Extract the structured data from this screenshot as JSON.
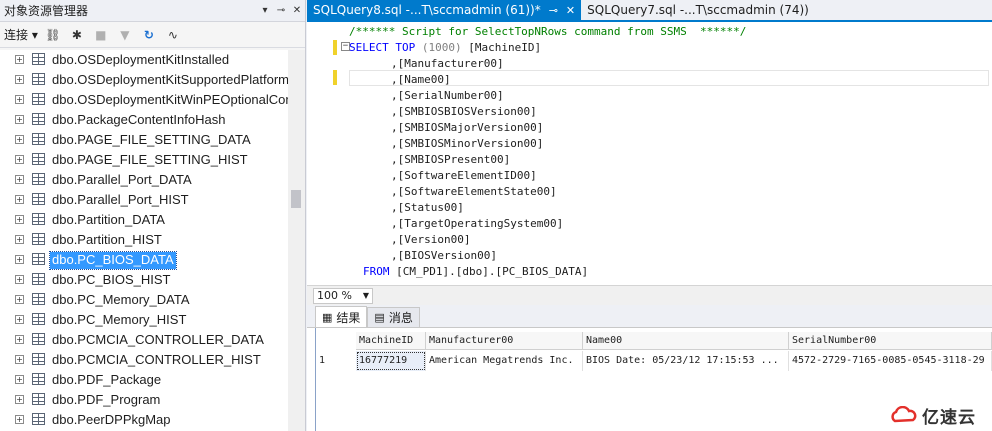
{
  "object_explorer": {
    "title": "对象资源管理器",
    "pin_label": "▾ ䷀",
    "close_label": "✕",
    "connect_label": "连接 ▾",
    "tree": [
      {
        "label": "dbo.OSDeploymentKitInstalled",
        "selected": false
      },
      {
        "label": "dbo.OSDeploymentKitSupportedPlatform",
        "selected": false
      },
      {
        "label": "dbo.OSDeploymentKitWinPEOptionalCom",
        "selected": false
      },
      {
        "label": "dbo.PackageContentInfoHash",
        "selected": false
      },
      {
        "label": "dbo.PAGE_FILE_SETTING_DATA",
        "selected": false
      },
      {
        "label": "dbo.PAGE_FILE_SETTING_HIST",
        "selected": false
      },
      {
        "label": "dbo.Parallel_Port_DATA",
        "selected": false
      },
      {
        "label": "dbo.Parallel_Port_HIST",
        "selected": false
      },
      {
        "label": "dbo.Partition_DATA",
        "selected": false
      },
      {
        "label": "dbo.Partition_HIST",
        "selected": false
      },
      {
        "label": "dbo.PC_BIOS_DATA",
        "selected": true
      },
      {
        "label": "dbo.PC_BIOS_HIST",
        "selected": false
      },
      {
        "label": "dbo.PC_Memory_DATA",
        "selected": false
      },
      {
        "label": "dbo.PC_Memory_HIST",
        "selected": false
      },
      {
        "label": "dbo.PCMCIA_CONTROLLER_DATA",
        "selected": false
      },
      {
        "label": "dbo.PCMCIA_CONTROLLER_HIST",
        "selected": false
      },
      {
        "label": "dbo.PDF_Package",
        "selected": false
      },
      {
        "label": "dbo.PDF_Program",
        "selected": false
      },
      {
        "label": "dbo.PeerDPPkgMap",
        "selected": false
      }
    ]
  },
  "tabs": [
    {
      "label": "SQLQuery8.sql -...T\\sccmadmin (61))*",
      "active": true
    },
    {
      "label": "SQLQuery7.sql -...T\\sccmadmin (74))",
      "active": false
    }
  ],
  "tab_pin": "⊸",
  "tab_close": "✕",
  "code": {
    "comment": "/****** Script for SelectTopNRows command from SSMS  ******/",
    "select_kw": "SELECT",
    "top_kw": "TOP",
    "top_arg": "(1000)",
    "first_col": "[MachineID]",
    "columns": [
      ",[Manufacturer00]",
      ",[Name00]",
      ",[SerialNumber00]",
      ",[SMBIOSBIOSVersion00]",
      ",[SMBIOSMajorVersion00]",
      ",[SMBIOSMinorVersion00]",
      ",[SMBIOSPresent00]",
      ",[SoftwareElementID00]",
      ",[SoftwareElementState00]",
      ",[Status00]",
      ",[TargetOperatingSystem00]",
      ",[Version00]",
      ",[BIOSVersion00]"
    ],
    "from_kw": "FROM",
    "from_table": "[CM_PD1].[dbo].[PC_BIOS_DATA]"
  },
  "zoom": "100 %",
  "result_tabs": [
    {
      "label": "结果",
      "active": true
    },
    {
      "label": "消息",
      "active": false
    }
  ],
  "grid": {
    "headers": [
      "MachineID",
      "Manufacturer00",
      "Name00",
      "SerialNumber00"
    ],
    "rows": [
      {
        "num": "1",
        "cells": [
          "16777219",
          "American Megatrends Inc.",
          "BIOS Date: 05/23/12 17:15:53 ...",
          "4572-2729-7165-0085-0545-3118-29"
        ]
      }
    ]
  },
  "watermark": "亿速云",
  "colors": {
    "accent": "#007acc",
    "selection": "#3399ff",
    "keyword": "#0000ff",
    "comment": "#008000"
  }
}
